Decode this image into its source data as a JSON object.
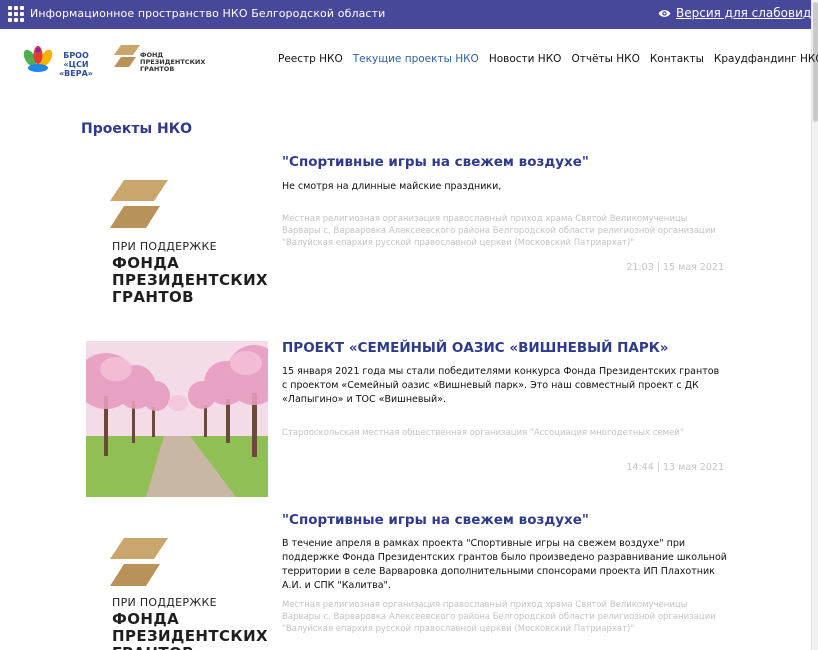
{
  "topbar": {
    "title": "Информационное пространство НКО Белгородской области",
    "accessibility_link": "Версия для слабовидящих"
  },
  "logos": {
    "vera_text_line1": "БРОО",
    "vera_text_line2": "«ЦСИ «ВЕРА»",
    "fpg_line1": "ФОНД",
    "fpg_line2": "ПРЕЗИДЕНТСКИХ",
    "fpg_line3": "ГРАНТОВ"
  },
  "nav": {
    "items": [
      {
        "label": "Реестр НКО"
      },
      {
        "label": "Текущие проекты НКО"
      },
      {
        "label": "Новости НКО"
      },
      {
        "label": "Отчёты НКО"
      },
      {
        "label": "Контакты"
      },
      {
        "label": "Краудфандинг НКО"
      }
    ]
  },
  "section_title": "Проекты НКО",
  "fpg_thumb": {
    "caption": "ПРИ ПОДДЕРЖКЕ",
    "line1": "ФОНДА",
    "line2": "ПРЕЗИДЕНТСКИХ",
    "line3": "ГРАНТОВ"
  },
  "articles": [
    {
      "title": "\"Спортивные игры на свежем воздухе\"",
      "text": "Не смотря на длинные майские праздники,",
      "org": "Местная религиозная организация православный приход храма Святой Великомученицы Варвары с. Варваровка Алексеевского района Белгородской области религиозной организации \"Валуйская епархия русской православной церкви (Московский Патриархат)\"",
      "date": "21:03 | 15 мая 2021"
    },
    {
      "title": "ПРОЕКТ «СЕМЕЙНЫЙ ОАЗИС «ВИШНЕВЫЙ ПАРК»",
      "text": "15 января 2021 года мы стали победителями конкурса Фонда Президентских грантов с проектом «Семейный оазис «Вишневый парк». Это наш совместный проект с ДК «Лапыгино» и ТОС «Вишневый».",
      "org": "Старооскольская местная общественная организация \"Ассоциация многодетных семей\"",
      "date": "14:44 | 13 мая 2021"
    },
    {
      "title": "\"Спортивные игры на свежем воздухе\"",
      "text": "В течение апреля в рамках проекта \"Спортивные игры на свежем воздухе\" при поддержке Фонда Президентских грантов было произведено разравнивание школьной территории в селе Варваровка дополнительными спонсорами проекта ИП Плахотник А.И. и СПК \"Калитва\".",
      "org": "Местная религиозная организация православный приход храма Святой Великомученицы Варвары с. Варваровка Алексеевского района Белгородской области религиозной организации \"Валуйская епархия русской православной церкви (Московский Патриархат)\""
    }
  ],
  "colors": {
    "topbar_bg": "#48489a",
    "title_blue": "#2e3a8c",
    "nav_active": "#2f5fa7",
    "fpg_gold": "#c9a66b",
    "muted": "#c4c4c4"
  }
}
